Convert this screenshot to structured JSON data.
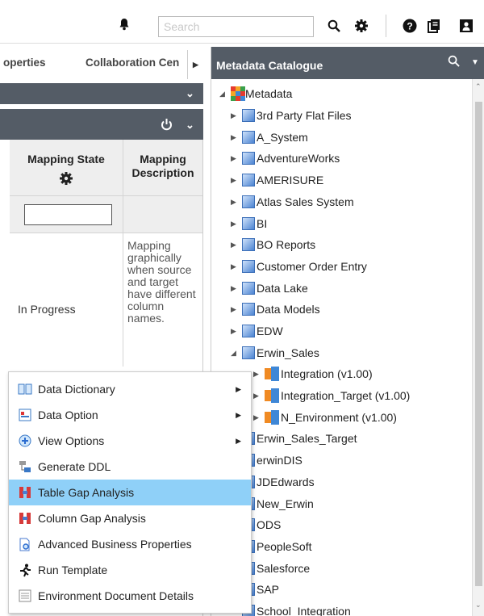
{
  "topbar": {
    "search_placeholder": "Search"
  },
  "tabs": {
    "tab1": "operties",
    "tab2": "Collaboration Cen"
  },
  "grid": {
    "col_state_header": "Mapping State",
    "col_desc_header": "Mapping Description",
    "row_state": "In Progress",
    "row_desc": "Mapping graphically when source and target have different column names."
  },
  "metadata": {
    "title": "Metadata Catalogue",
    "root": "Metadata",
    "items": [
      "3rd Party Flat Files",
      "A_System",
      "AdventureWorks",
      "AMERISURE",
      "Atlas Sales System",
      "BI",
      "BO Reports",
      "Customer Order Entry",
      "Data Lake",
      "Data Models",
      "EDW",
      "Erwin_Sales"
    ],
    "children": [
      "Integration (v1.00)",
      "Integration_Target (v1.00)",
      "N_Environment (v1.00)"
    ],
    "after": [
      "Erwin_Sales_Target",
      "erwinDIS",
      "JDEdwards",
      "New_Erwin",
      "ODS",
      "PeopleSoft",
      "Salesforce",
      "SAP",
      "School_Integration"
    ]
  },
  "menu": {
    "items": [
      "Data Dictionary",
      "Data Option",
      "View Options",
      "Generate DDL",
      "Table Gap Analysis",
      "Column Gap Analysis",
      "Advanced Business Properties",
      "Run Template",
      "Environment Document Details"
    ]
  },
  "colors": {
    "header_bg": "#545c66",
    "menu_selected": "#8fd0f8"
  }
}
